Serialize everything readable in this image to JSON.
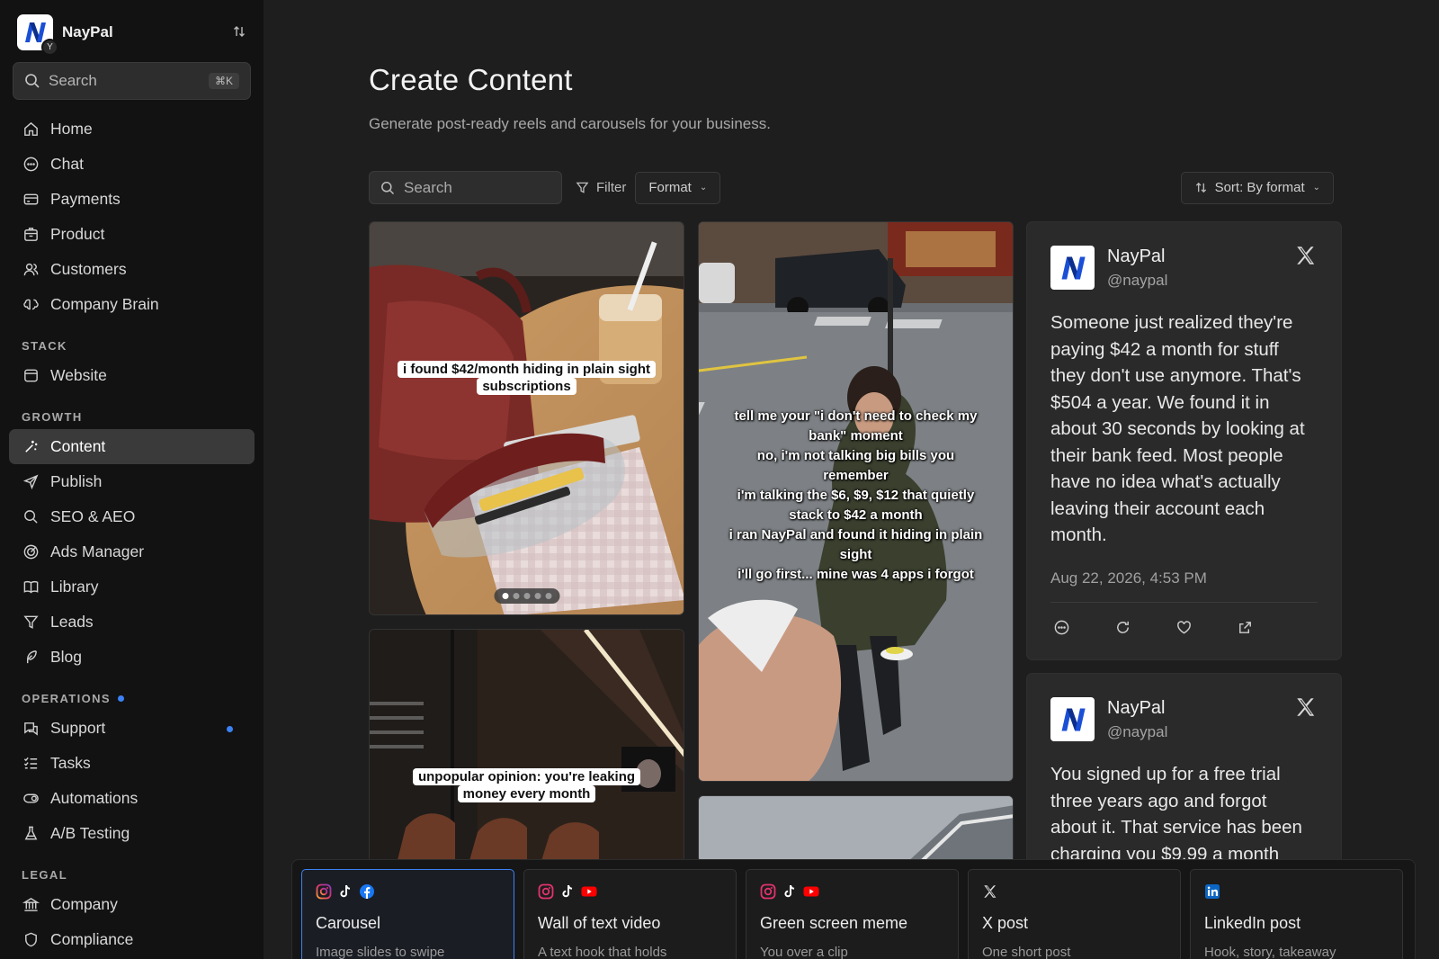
{
  "workspace": {
    "name": "NayPal",
    "badge": "Y"
  },
  "sidebar": {
    "search_placeholder": "Search",
    "search_shortcut": "⌘K",
    "primary": [
      {
        "label": "Home",
        "icon": "home-icon"
      },
      {
        "label": "Chat",
        "icon": "chat-icon"
      },
      {
        "label": "Payments",
        "icon": "card-icon"
      },
      {
        "label": "Product",
        "icon": "box-icon"
      },
      {
        "label": "Customers",
        "icon": "users-icon"
      },
      {
        "label": "Company Brain",
        "icon": "brain-icon"
      }
    ],
    "stack_label": "STACK",
    "stack": [
      {
        "label": "Website",
        "icon": "browser-icon"
      }
    ],
    "growth_label": "GROWTH",
    "growth": [
      {
        "label": "Content",
        "icon": "magic-wand-icon",
        "active": true
      },
      {
        "label": "Publish",
        "icon": "send-icon"
      },
      {
        "label": "SEO & AEO",
        "icon": "search-icon"
      },
      {
        "label": "Ads Manager",
        "icon": "target-icon"
      },
      {
        "label": "Library",
        "icon": "book-icon"
      },
      {
        "label": "Leads",
        "icon": "funnel-icon"
      },
      {
        "label": "Blog",
        "icon": "feather-icon"
      }
    ],
    "operations_label": "OPERATIONS",
    "operations": [
      {
        "label": "Support",
        "icon": "support-icon"
      },
      {
        "label": "Tasks",
        "icon": "list-icon"
      },
      {
        "label": "Automations",
        "icon": "toggle-icon"
      },
      {
        "label": "A/B Testing",
        "icon": "flask-icon"
      }
    ],
    "legal_label": "LEGAL",
    "legal": [
      {
        "label": "Company",
        "icon": "bank-icon"
      },
      {
        "label": "Compliance",
        "icon": "shield-icon"
      }
    ]
  },
  "main": {
    "title": "Create Content",
    "subtitle": "Generate post-ready reels and carousels for your business.",
    "search_placeholder": "Search",
    "filter_label": "Filter",
    "format_label": "Format",
    "sort_label": "Sort: By format"
  },
  "media": {
    "card1_caption": "i found $42/month hiding in plain sight subscriptions",
    "card2_lines": [
      "tell me your \"i don't need to check my bank\" moment",
      "no, i'm not talking big bills you remember",
      "i'm talking the $6, $9, $12 that quietly stack to $42 a month",
      "i ran NayPal and found it hiding in plain sight",
      "i'll go first... mine was 4 apps i forgot"
    ],
    "card3_caption": "unpopular opinion: you're leaking money every month"
  },
  "posts": [
    {
      "name": "NayPal",
      "handle": "@naypal",
      "text": "Someone just realized they're paying $42 a month for stuff they don't use anymore. That's $504 a year. We found it in about 30 seconds by looking at their bank feed. Most people have no idea what's actually leaving their account each month.",
      "date": "Aug 22, 2026, 4:53 PM"
    },
    {
      "name": "NayPal",
      "handle": "@naypal",
      "text": "You signed up for a free trial three years ago and forgot about it. That service has been charging you $9.99 a month"
    }
  ],
  "formats": [
    {
      "title": "Carousel",
      "desc": "Image slides to swipe",
      "platforms": [
        "instagram-icon",
        "tiktok-icon",
        "facebook-icon"
      ],
      "selected": true
    },
    {
      "title": "Wall of text video",
      "desc": "A text hook that holds",
      "platforms": [
        "instagram-icon",
        "tiktok-icon",
        "youtube-icon"
      ]
    },
    {
      "title": "Green screen meme",
      "desc": "You over a clip",
      "platforms": [
        "instagram-icon",
        "tiktok-icon",
        "youtube-icon"
      ]
    },
    {
      "title": "X post",
      "desc": "One short post",
      "platforms": [
        "x-icon"
      ]
    },
    {
      "title": "LinkedIn post",
      "desc": "Hook, story, takeaway",
      "platforms": [
        "linkedin-icon"
      ]
    }
  ],
  "colors": {
    "accent": "#3b82f6",
    "sidebar_bg": "#121212",
    "main_bg": "#1e1e1e",
    "brand_blue": "#1a4fd6"
  }
}
